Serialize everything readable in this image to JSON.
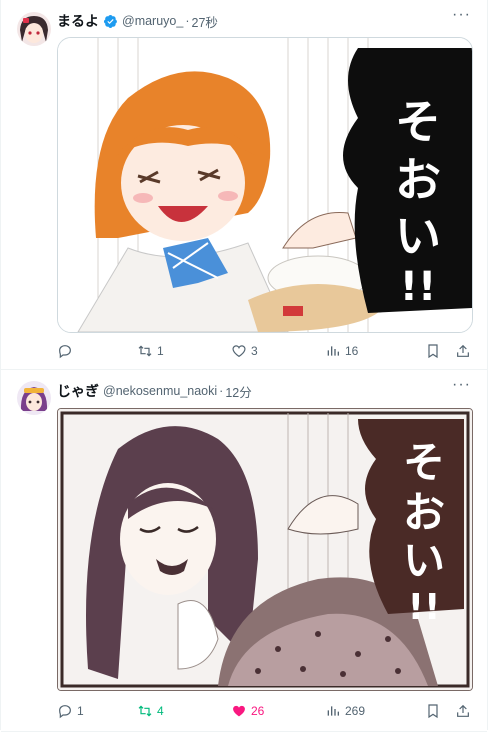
{
  "posts": [
    {
      "display_name": "まるよ",
      "handle": "@maruyo_",
      "separator": "·",
      "time": "27秒",
      "verified": true,
      "media_text": "そおい!!",
      "replies": "",
      "retweets": "1",
      "likes": "3",
      "views": "16",
      "liked": false,
      "retweeted": false
    },
    {
      "display_name": "じゃぎ",
      "handle": "@nekosenmu_naoki",
      "separator": "·",
      "time": "12分",
      "verified": false,
      "media_text": "そおい!!",
      "replies": "1",
      "retweets": "4",
      "likes": "26",
      "views": "269",
      "liked": true,
      "retweeted": true
    }
  ],
  "icons": {
    "more": "more-icon",
    "reply": "reply-icon",
    "retweet": "retweet-icon",
    "like": "heart-icon",
    "views": "views-icon",
    "bookmark": "bookmark-icon",
    "share": "share-icon",
    "verified": "verified-badge-icon"
  },
  "colors": {
    "text_secondary": "#536471",
    "verified_blue": "#1d9bf0",
    "retweet_green": "#00ba7c",
    "like_pink": "#f91880"
  }
}
